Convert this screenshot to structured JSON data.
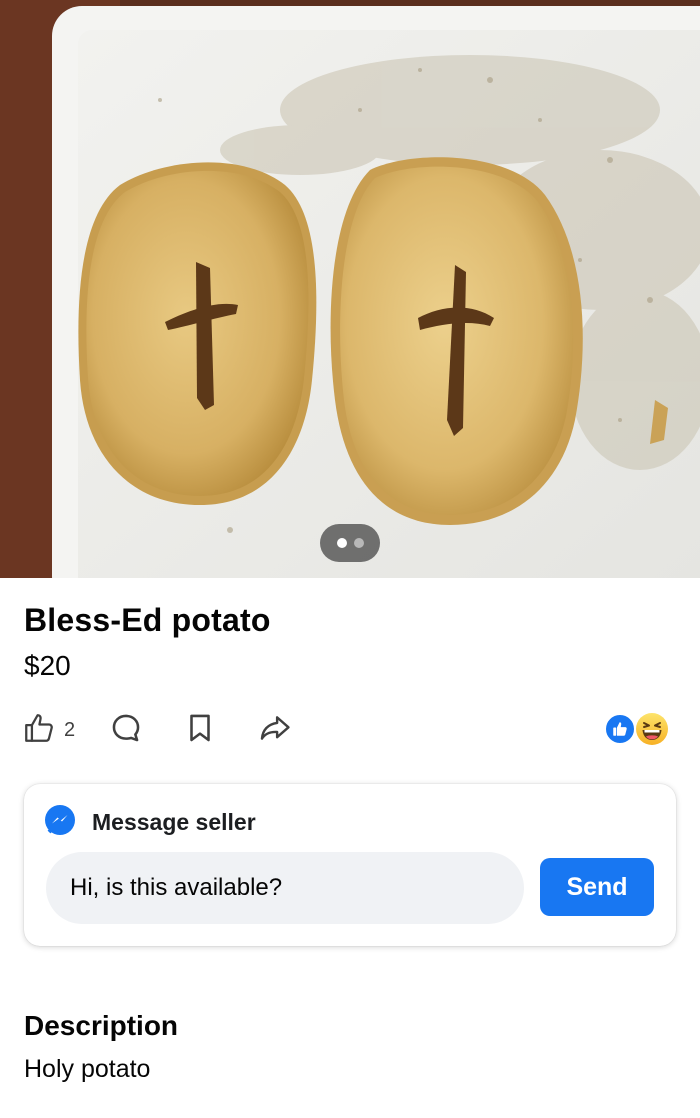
{
  "listing": {
    "title": "Bless-Ed potato",
    "price": "$20",
    "photo": {
      "subject": "two potato halves with cross-shaped cuts on a cutting board",
      "carousel_current": 1,
      "carousel_total": 2
    }
  },
  "actions": {
    "like_icon": "thumbs-up-icon",
    "like_count": "2",
    "comment_icon": "comment-icon",
    "save_icon": "bookmark-icon",
    "share_icon": "share-icon"
  },
  "reactions": [
    "like",
    "haha"
  ],
  "message": {
    "icon": "messenger-icon",
    "heading": "Message seller",
    "input_value": "Hi, is this available?",
    "send_label": "Send"
  },
  "description": {
    "heading": "Description",
    "text": "Holy potato"
  },
  "colors": {
    "accent": "#1877f2",
    "input_bg": "#f0f2f5",
    "text": "#050505"
  }
}
